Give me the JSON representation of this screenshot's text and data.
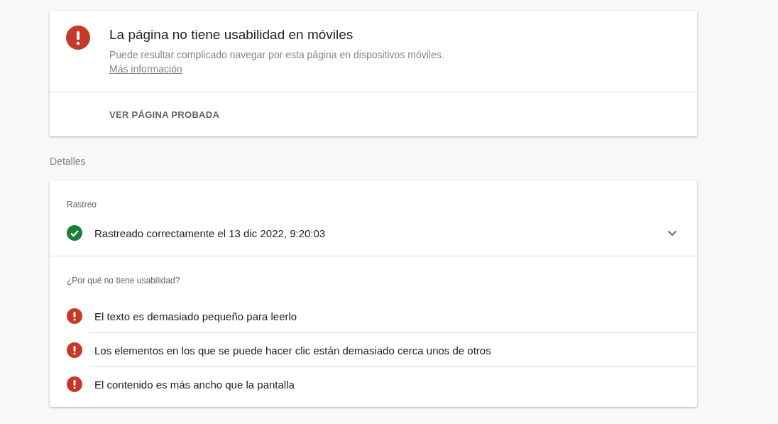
{
  "summary": {
    "kind": "error",
    "title": "La página no tiene usabilidad en móviles",
    "description": "Puede resultar complicado navegar por esta página en dispositivos móviles.",
    "link": "Más información",
    "action": "VER PÁGINA PROBADA"
  },
  "details_heading": "Detalles",
  "details": {
    "crawl": {
      "heading": "Rastreo",
      "kind": "success",
      "text": "Rastreado correctamente el 13 dic 2022, 9:20:03",
      "expanded": false
    },
    "issues_heading": "¿Por qué no tiene usabilidad?",
    "issues": [
      {
        "kind": "error",
        "text": "El texto es demasiado pequeño para leerlo"
      },
      {
        "kind": "error",
        "text": "Los elementos en los que se puede hacer clic están demasiado cerca unos de otros"
      },
      {
        "kind": "error",
        "text": "El contenido es más ancho que la pantalla"
      }
    ]
  }
}
